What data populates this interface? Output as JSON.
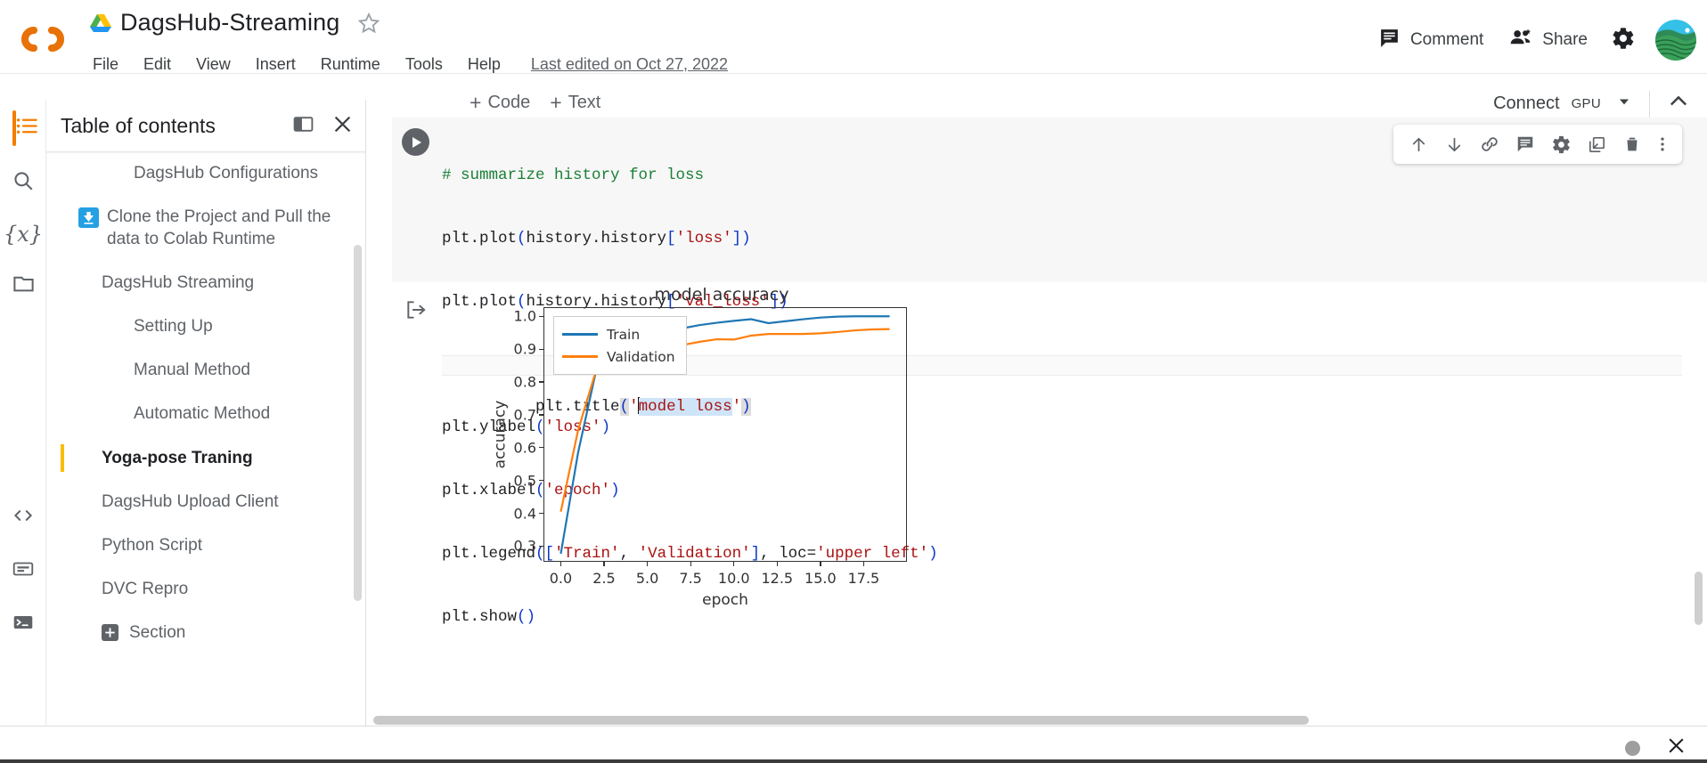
{
  "app": {
    "logo": "colab-logo",
    "drive_icon": "drive-icon",
    "title": "DagsHub-Streaming",
    "star_icon": "star-icon",
    "menu": [
      "File",
      "Edit",
      "View",
      "Insert",
      "Runtime",
      "Tools",
      "Help"
    ],
    "last_edited": "Last edited on Oct 27, 2022"
  },
  "top_right": {
    "comment_label": "Comment",
    "comment_icon": "comment-icon",
    "share_label": "Share",
    "share_icon": "people-icon",
    "settings_icon": "gear-icon",
    "avatar": "user-avatar"
  },
  "subbar": {
    "add_code": "+ Code",
    "add_code_label": "Code",
    "add_text_label": "Text",
    "connect_label": "Connect",
    "runtime_type": "GPU",
    "caret_icon": "chevron-down-icon",
    "collapse_icon": "chevron-up-icon"
  },
  "rail": {
    "items": [
      {
        "name": "toc-icon",
        "label": "Table of contents"
      },
      {
        "name": "search-icon",
        "label": "Find and replace"
      },
      {
        "name": "variables-icon",
        "label": "Variables"
      },
      {
        "name": "files-icon",
        "label": "Files"
      },
      {
        "name": "code-snippets-icon",
        "label": "Code snippets"
      },
      {
        "name": "command-palette-icon",
        "label": "Command palette"
      },
      {
        "name": "terminal-icon",
        "label": "Terminal"
      }
    ]
  },
  "toc": {
    "title": "Table of contents",
    "expand_icon": "expand-panel-icon",
    "close_icon": "close-icon",
    "items": [
      {
        "label": "DagsHub Configurations",
        "level": 1,
        "current": false,
        "icon": null
      },
      {
        "label": "Clone the Project and Pull the data to Colab Runtime",
        "level": 0,
        "current": false,
        "icon": "download-badge-icon"
      },
      {
        "label": "DagsHub Streaming",
        "level": 0,
        "current": false,
        "icon": null
      },
      {
        "label": "Setting Up",
        "level": 1,
        "current": false,
        "icon": null
      },
      {
        "label": "Manual Method",
        "level": 1,
        "current": false,
        "icon": null
      },
      {
        "label": "Automatic Method",
        "level": 1,
        "current": false,
        "icon": null
      },
      {
        "label": "Yoga-pose Traning",
        "level": 0,
        "current": true,
        "icon": null
      },
      {
        "label": "DagsHub Upload Client",
        "level": 0,
        "current": false,
        "icon": null
      },
      {
        "label": "Python Script",
        "level": 0,
        "current": false,
        "icon": null
      },
      {
        "label": "DVC Repro",
        "level": 0,
        "current": false,
        "icon": null
      },
      {
        "label": "Section",
        "level": 0,
        "current": false,
        "icon": "add-section-icon"
      }
    ]
  },
  "cell": {
    "run_icon": "run-cell-icon",
    "output_icon": "output-arrow-icon",
    "toolbar_icons": [
      "move-cell-up-icon",
      "move-cell-down-icon",
      "link-to-cell-icon",
      "add-comment-icon",
      "cell-settings-icon",
      "open-in-new-tab-icon",
      "delete-cell-icon",
      "more-options-icon"
    ],
    "code_lines": [
      {
        "type": "comment",
        "text": "# summarize history for loss"
      },
      {
        "type": "code",
        "text": "plt.plot(history.history['loss'])"
      },
      {
        "type": "code",
        "text": "plt.plot(history.history['val_loss'])"
      },
      {
        "type": "code",
        "text": "plt.title('model loss')",
        "active": true
      },
      {
        "type": "code",
        "text": "plt.ylabel('loss')"
      },
      {
        "type": "code",
        "text": "plt.xlabel('epoch')"
      },
      {
        "type": "code",
        "text": "plt.legend(['Train', 'Validation'], loc='upper left')"
      },
      {
        "type": "code",
        "text": "plt.show()"
      }
    ]
  },
  "chart_data": {
    "type": "line",
    "title": "model accuracy",
    "xlabel": "epoch",
    "ylabel": "accuracy",
    "xlim": [
      -0.95,
      19.95
    ],
    "ylim": [
      0.255,
      1.025
    ],
    "xticks": [
      0.0,
      2.5,
      5.0,
      7.5,
      10.0,
      12.5,
      15.0,
      17.5
    ],
    "xtick_labels": [
      "0.0",
      "2.5",
      "5.0",
      "7.5",
      "10.0",
      "12.5",
      "15.0",
      "17.5"
    ],
    "yticks": [
      0.3,
      0.4,
      0.5,
      0.6,
      0.7,
      0.8,
      0.9,
      1.0
    ],
    "ytick_labels": [
      "0.3",
      "0.4",
      "0.5",
      "0.6",
      "0.7",
      "0.8",
      "0.9",
      "1.0"
    ],
    "grid": false,
    "legend_position": "upper left",
    "x": [
      0,
      1,
      2,
      3,
      4,
      5,
      6,
      7,
      8,
      9,
      10,
      11,
      12,
      13,
      14,
      15,
      16,
      17,
      18,
      19
    ],
    "series": [
      {
        "name": "Train",
        "color": "#1f77b4",
        "values": [
          0.277,
          0.585,
          0.825,
          0.872,
          0.913,
          0.941,
          0.952,
          0.963,
          0.973,
          0.98,
          0.986,
          0.991,
          0.979,
          0.985,
          0.991,
          0.996,
          0.999,
          1.0,
          1.0,
          1.0
        ]
      },
      {
        "name": "Validation",
        "color": "#ff7f0e",
        "values": [
          0.405,
          0.653,
          0.828,
          0.87,
          0.896,
          0.89,
          0.901,
          0.912,
          0.922,
          0.93,
          0.929,
          0.941,
          0.946,
          0.946,
          0.946,
          0.948,
          0.952,
          0.957,
          0.96,
          0.961
        ]
      }
    ]
  },
  "statusbar": {
    "dot_icon": "status-dot-icon",
    "close_icon": "close-icon"
  }
}
